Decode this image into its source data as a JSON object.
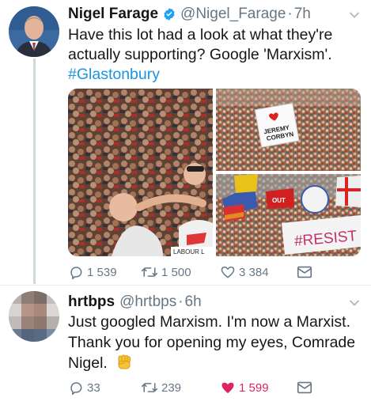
{
  "tweet1": {
    "name": "Nigel Farage",
    "handle": "@Nigel_Farage",
    "separator": "·",
    "time": "7h",
    "text_line1": "Have this lot had a look at what they're",
    "text_line2": "actually supporting? Google 'Marxism'.",
    "hashtag": "#Glastonbury",
    "media": {
      "sign_line1": "JEREMY",
      "sign_line2": "CORBYN",
      "banner_labour": "LABOUR L",
      "banner_resist": "#RESIST",
      "banner_out": "OUT"
    },
    "replies": "1 539",
    "retweets": "1 500",
    "likes": "3 384"
  },
  "tweet2": {
    "name": "hrtbps",
    "handle": "@hrtbps",
    "separator": "·",
    "time": "6h",
    "text_line1": "Just googled Marxism. I'm now a Marxist.",
    "text_line2": "Thank you for opening my eyes, Comrade",
    "text_line3": "Nigel.",
    "emoji": "raised-fist",
    "replies": "33",
    "retweets": "239",
    "likes": "1 599"
  },
  "colors": {
    "link": "#1b95e0",
    "muted": "#657786",
    "like": "#e0245e",
    "verified": "#1da1f2"
  }
}
